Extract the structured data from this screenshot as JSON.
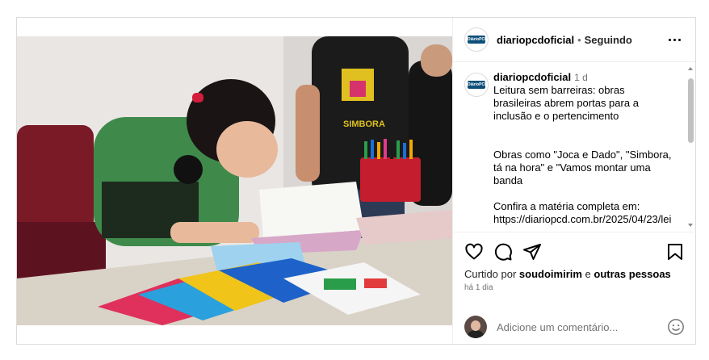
{
  "post": {
    "username": "diariopcdoficial",
    "separator": "•",
    "follow_state": "Seguindo",
    "avatar_logo_text": "DiárioPCD"
  },
  "caption": {
    "username": "diariopcdoficial",
    "time": "1 d",
    "line1": "Leitura sem barreiras: obras brasileiras abrem portas para a inclusão e o pertencimento",
    "line2": "Obras como \"Joca e Dado\", \"Simbora, tá na hora\" e \"Vamos montar uma banda",
    "line3": "Confira a matéria completa em: https://diariopcd.com.br/2025/04/23/lei"
  },
  "likes": {
    "prefix": "Curtido por ",
    "user": "soudoimirim",
    "middle": " e ",
    "others": "outras pessoas"
  },
  "time_ago": "há 1 dia",
  "comment_box": {
    "placeholder": "Adicione um comentário..."
  },
  "icons": {
    "like": "heart-icon",
    "comment": "comment-icon",
    "share": "send-icon",
    "save": "bookmark-icon",
    "more": "more-options-icon",
    "emoji": "emoji-icon"
  },
  "colors": {
    "border": "#dbdbdb",
    "muted": "#737373",
    "brand_logo": "#0e4f7a"
  }
}
